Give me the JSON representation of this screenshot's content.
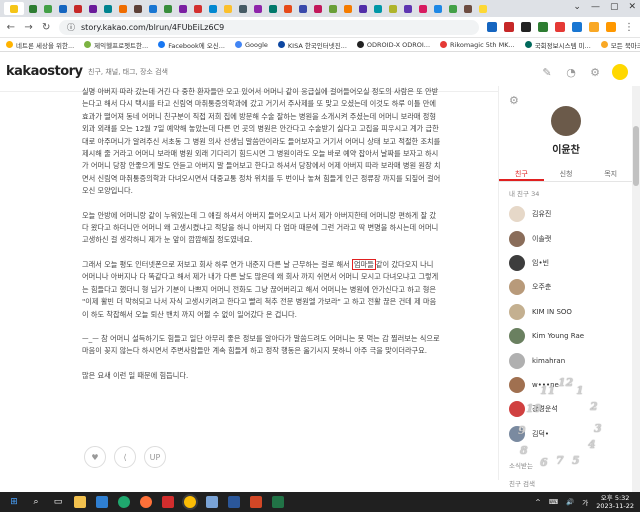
{
  "browser": {
    "url": "story.kakao.com/blrun/4FUbEiLz6C9",
    "tab_colors": [
      "#f5c518",
      "#2e7d32",
      "#43a047",
      "#1565c0",
      "#c62828",
      "#6a1b9a",
      "#00838f",
      "#ef6c00",
      "#5d4037",
      "#1976d2",
      "#388e3c",
      "#7b1fa2",
      "#d32f2f",
      "#0288d1",
      "#fbc02d",
      "#455a64",
      "#8e24aa",
      "#00796b",
      "#e64a19",
      "#3949ab",
      "#c2185b",
      "#689f38",
      "#f57c00",
      "#512da8",
      "#0097a7",
      "#afb42b",
      "#5e35b1",
      "#d81b60",
      "#1e88e5",
      "#43a047",
      "#6d4c41",
      "#fdd835"
    ],
    "window_controls": [
      "⌄",
      "—",
      "▢",
      "✕"
    ],
    "extension_colors": [
      "#1565c0",
      "#c62828",
      "#222222",
      "#2e7d32",
      "#e53935",
      "#1976d2",
      "#f9a825",
      "#ff9800"
    ],
    "profile_text": "⋮"
  },
  "bookmarks": [
    {
      "label": "네트론 세상을 위한...",
      "color": "#ffb300"
    },
    {
      "label": "제익헬프로젯트한...",
      "color": "#7cb342"
    },
    {
      "label": "Facebook에 오신...",
      "color": "#1877f2"
    },
    {
      "label": "Google",
      "color": "#4285f4"
    },
    {
      "label": "KISA 한국인터넷진...",
      "color": "#0d47a1"
    },
    {
      "label": "ODROID-X ODROI...",
      "color": "#222222"
    },
    {
      "label": "Rikomagic 5th MK...",
      "color": "#e53935"
    },
    {
      "label": "국회정보시스템 미...",
      "color": "#00695c"
    },
    {
      "label": "모든 북마크",
      "color": "#f9a825"
    }
  ],
  "header": {
    "logo": "kakaostory",
    "search_placeholder": "친구, 채널, 태그, 장소 검색",
    "icons": [
      "pencil-icon",
      "bell-icon",
      "settings-icon"
    ]
  },
  "article": {
    "p1": "실명 아버지 따라 갔는데 거긴 다 중한 환자들만 오고 있어서 어머니 같이 응급실에 걸어들어오실 정도의 사람은 또 안받는다고 해서 다시 택시를 타고 신림역 마취통증의학과에 갔고 거기서 주사제를 또 맞고 오셨는데 이것도 하루 이틀 만에 효과가 떨어져 동네 어머니 친구분이 직접 저희 집에 방문해 수술 잘하는 병원을 소개시켜 주셨는데 어머니 보라매 정형외과 외래를 오는 12월 7일 예약해 놓았는데 다른 먼 곳의 병원은 안간다고 수술받기 싫다고 고집을 피우시고 계가 급한대로 아주머니가 알려주신 서초동 그 병원 의사 선생님 말씀만이라도 들어보자고 거기서 어머니 상태 보고 적절한 조치를 제시해 줄 거라고 어머니 보라매 병원 외래 기다리기 힘드시면 그 병원이라도 오늘 바로 예약 잡아서 날짜를 보자고 하시가 어머니 당장 안좋으게 말도 안듣고 아버지 말 들어보고 한다고 하셔서 당장에서 어제 아버지 따라 보라매 병원 원장 치면서 신림역 마취통증의학과 다녀오시면서 대중교통 정차 위치를 두 번이나 놓쳐 힘들게 인근 정류장 까지를 되짚어 걸어오신 모양입니다.",
    "p2": "오늘 안방에 어머니랑 같이 누워있는데 그 얘길 하셔서 아버지 들어오시고 나서 제가 아버지한테 어머니랑 편하게 잘 갔다 왔다고 하더니만 어머니 왜 고생시켰냐고 적당을 하니 아버지 다 엄마 때문에 그런 거라고 딱 변명을 하시는데 어머니 고생하신 걸 생각하니 제가 눈 앞이 깜깜해질 정도였네요.",
    "p3_before": "그래서 오늘 평도 인터넷폰으로 저보고 회사 하루 연가 내준지 다른 날 근무하는 걸로 해서 ",
    "p3_highlight": "엄마들",
    "p3_after": "같이 갔다오지 나니 어머니나 아버지나 다 똑같다고 해서 제가 내가 다른 날도 많은데 왜 회사 까지 쉬면서 어머니 모시고 다녀오냐고 그렇게는 힘들다고 했더니 형 님가 기분이 나쁘지 어머니 전화도 그냥 끊어버리고 해서 어머니는 병원에 안가신다고 하고 형은 \"이제 활빈 더 막혀되고 나서 자식 고생시키려고 한다고 빨리 척추 전문 병원엘 가보라\" 고 하고 전활 끊은 건데 제 마음이 하도 착잡해서 오늘 퇴산 밴치 까지 어쩔 수 없이 일어갔다 온 겁니다.",
    "p4": "ㅡ_ㅡ 참 어머니 설득하기도 힘들고 일단 아무리 좋은 정보를 알아다가 말씀드려도 어머니는 못 먹는 감 찔러보는 식으로 마음이 꽂지 않는다 하시면서 주변사람들만 계속 힘들게 하고 정작 행동은 옮기시지 못하니 아주 극을 맞이더라구요.",
    "p5": "많은 요새 이런 일 때문에 힘듭니다.",
    "actions": [
      "♥",
      "⟨",
      "UP"
    ]
  },
  "sidebar": {
    "profile_name": "이윤찬",
    "tabs": [
      "친구",
      "신청",
      "목지"
    ],
    "friend_count": "내 친구 34",
    "friends": [
      {
        "name": "김유진",
        "color": "#e6d8c8"
      },
      {
        "name": "이솔랫",
        "color": "#8a6d5a"
      },
      {
        "name": "임•빈",
        "color": "#3d3d3d"
      },
      {
        "name": "오주춘",
        "color": "#b89a7a"
      },
      {
        "name": "KIM IN SOO",
        "color": "#c4b090"
      },
      {
        "name": "Kim Young Rae",
        "color": "#6a8060"
      },
      {
        "name": "kimahran",
        "color": "#b0b0b0"
      },
      {
        "name": "w•••ne",
        "color": "#a07050"
      },
      {
        "name": "강경운석",
        "color": "#d04040"
      },
      {
        "name": "김덕•",
        "color": "#7a8aa0"
      }
    ],
    "footer": "소식받는",
    "footer2": "친구 검색"
  },
  "clock_numbers": [
    "12",
    "11",
    "1",
    "2",
    "10",
    "3",
    "9",
    "4",
    "8",
    "5",
    "7",
    "6"
  ],
  "taskbar": {
    "time": "오후 5:32",
    "date": "2023-11-22",
    "lang": "가",
    "tray": [
      "^",
      "⌨",
      "🔊",
      "가"
    ]
  }
}
